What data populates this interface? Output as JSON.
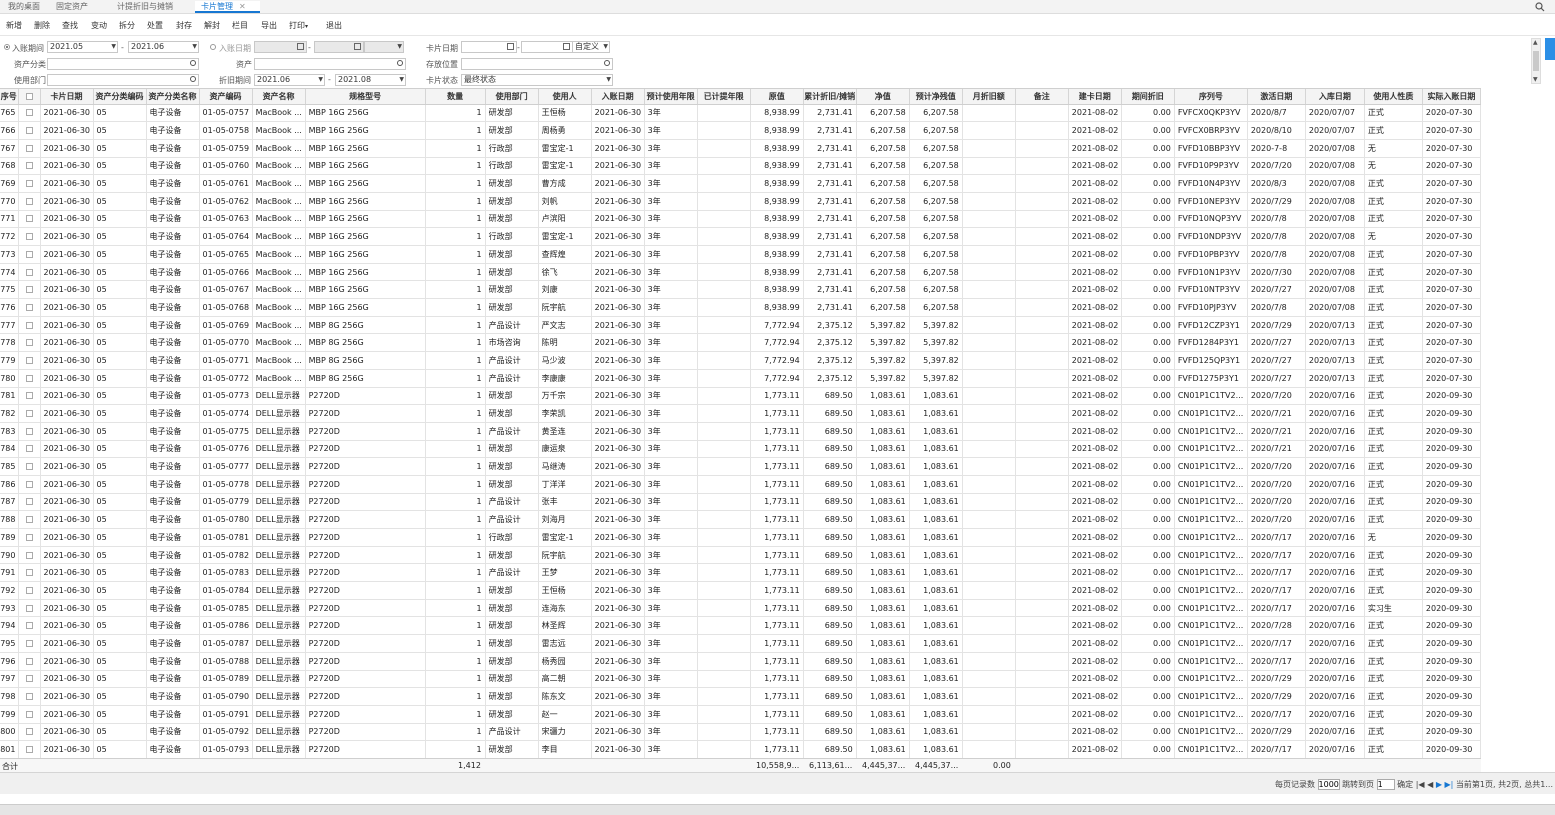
{
  "tabs": [
    {
      "label": "我的桌面",
      "active": false
    },
    {
      "label": "固定资产",
      "active": false
    },
    {
      "label": "计提折旧与摊销",
      "active": false
    },
    {
      "label": "卡片管理",
      "active": true
    }
  ],
  "toolbar": [
    "新增",
    "删除",
    "查找",
    "变动",
    "拆分",
    "处置",
    "封存",
    "解封",
    "栏目",
    "导出",
    "打印",
    "退出"
  ],
  "filters": {
    "entry_period_label": "入账期间",
    "entry_period_from": "2021.05",
    "entry_period_to": "2021.06",
    "entry_date_label": "入账日期",
    "card_date_label": "卡片日期",
    "card_date_mode": "自定义",
    "asset_category_label": "资产分类",
    "asset_label": "资产",
    "storage_label": "存放位置",
    "dept_label": "使用部门",
    "depr_period_label": "折旧期间",
    "depr_period_from": "2021.06",
    "depr_period_to": "2021.08",
    "card_status_label": "卡片状态",
    "card_status_value": "最终状态"
  },
  "columns": [
    "序号",
    "",
    "卡片日期",
    "资产分类编码",
    "资产分类名称",
    "资产编码",
    "资产名称",
    "规格型号",
    "数量",
    "使用部门",
    "使用人",
    "入账日期",
    "预计使用年限",
    "已计提年限",
    "原值",
    "累计折旧/摊销",
    "净值",
    "预计净残值",
    "月折旧额",
    "备注",
    "建卡日期",
    "期间折旧",
    "序列号",
    "激活日期",
    "入库日期",
    "使用人性质",
    "实际入账日期"
  ],
  "rows": [
    [
      "765",
      "",
      "2021-06-30",
      "05",
      "电子设备",
      "01-05-0757",
      "MacBook ...",
      "MBP 16G 256G",
      "1",
      "研发部",
      "王恒杨",
      "2021-06-30",
      "3年",
      "",
      "8,938.99",
      "2,731.41",
      "6,207.58",
      "6,207.58",
      "",
      "",
      "2021-08-02",
      "0.00",
      "FVFCX0QKP3YV",
      "2020/8/7",
      "2020/07/07",
      "正式",
      "2020-07-30"
    ],
    [
      "766",
      "",
      "2021-06-30",
      "05",
      "电子设备",
      "01-05-0758",
      "MacBook ...",
      "MBP 16G 256G",
      "1",
      "研发部",
      "周杨勇",
      "2021-06-30",
      "3年",
      "",
      "8,938.99",
      "2,731.41",
      "6,207.58",
      "6,207.58",
      "",
      "",
      "2021-08-02",
      "0.00",
      "FVFCX0BRP3YV",
      "2020/8/10",
      "2020/07/07",
      "正式",
      "2020-07-30"
    ],
    [
      "767",
      "",
      "2021-06-30",
      "05",
      "电子设备",
      "01-05-0759",
      "MacBook ...",
      "MBP 16G 256G",
      "1",
      "行政部",
      "雷宝定-1",
      "2021-06-30",
      "3年",
      "",
      "8,938.99",
      "2,731.41",
      "6,207.58",
      "6,207.58",
      "",
      "",
      "2021-08-02",
      "0.00",
      "FVFD10BBP3YV",
      "2020-7-8",
      "2020/07/08",
      "无",
      "2020-07-30"
    ],
    [
      "768",
      "",
      "2021-06-30",
      "05",
      "电子设备",
      "01-05-0760",
      "MacBook ...",
      "MBP 16G 256G",
      "1",
      "行政部",
      "雷宝定-1",
      "2021-06-30",
      "3年",
      "",
      "8,938.99",
      "2,731.41",
      "6,207.58",
      "6,207.58",
      "",
      "",
      "2021-08-02",
      "0.00",
      "FVFD10P9P3YV",
      "2020/7/20",
      "2020/07/08",
      "无",
      "2020-07-30"
    ],
    [
      "769",
      "",
      "2021-06-30",
      "05",
      "电子设备",
      "01-05-0761",
      "MacBook ...",
      "MBP 16G 256G",
      "1",
      "研发部",
      "曹方成",
      "2021-06-30",
      "3年",
      "",
      "8,938.99",
      "2,731.41",
      "6,207.58",
      "6,207.58",
      "",
      "",
      "2021-08-02",
      "0.00",
      "FVFD10N4P3YV",
      "2020/8/3",
      "2020/07/08",
      "正式",
      "2020-07-30"
    ],
    [
      "770",
      "",
      "2021-06-30",
      "05",
      "电子设备",
      "01-05-0762",
      "MacBook ...",
      "MBP 16G 256G",
      "1",
      "研发部",
      "刘帆",
      "2021-06-30",
      "3年",
      "",
      "8,938.99",
      "2,731.41",
      "6,207.58",
      "6,207.58",
      "",
      "",
      "2021-08-02",
      "0.00",
      "FVFD10NEP3YV",
      "2020/7/29",
      "2020/07/08",
      "正式",
      "2020-07-30"
    ],
    [
      "771",
      "",
      "2021-06-30",
      "05",
      "电子设备",
      "01-05-0763",
      "MacBook ...",
      "MBP 16G 256G",
      "1",
      "研发部",
      "卢滨阳",
      "2021-06-30",
      "3年",
      "",
      "8,938.99",
      "2,731.41",
      "6,207.58",
      "6,207.58",
      "",
      "",
      "2021-08-02",
      "0.00",
      "FVFD10NQP3YV",
      "2020/7/8",
      "2020/07/08",
      "正式",
      "2020-07-30"
    ],
    [
      "772",
      "",
      "2021-06-30",
      "05",
      "电子设备",
      "01-05-0764",
      "MacBook ...",
      "MBP 16G 256G",
      "1",
      "行政部",
      "雷宝定-1",
      "2021-06-30",
      "3年",
      "",
      "8,938.99",
      "2,731.41",
      "6,207.58",
      "6,207.58",
      "",
      "",
      "2021-08-02",
      "0.00",
      "FVFD10NDP3YV",
      "2020/7/8",
      "2020/07/08",
      "无",
      "2020-07-30"
    ],
    [
      "773",
      "",
      "2021-06-30",
      "05",
      "电子设备",
      "01-05-0765",
      "MacBook ...",
      "MBP 16G 256G",
      "1",
      "研发部",
      "查辉煌",
      "2021-06-30",
      "3年",
      "",
      "8,938.99",
      "2,731.41",
      "6,207.58",
      "6,207.58",
      "",
      "",
      "2021-08-02",
      "0.00",
      "FVFD10PBP3YV",
      "2020/7/8",
      "2020/07/08",
      "正式",
      "2020-07-30"
    ],
    [
      "774",
      "",
      "2021-06-30",
      "05",
      "电子设备",
      "01-05-0766",
      "MacBook ...",
      "MBP 16G 256G",
      "1",
      "研发部",
      "徐飞",
      "2021-06-30",
      "3年",
      "",
      "8,938.99",
      "2,731.41",
      "6,207.58",
      "6,207.58",
      "",
      "",
      "2021-08-02",
      "0.00",
      "FVFD10N1P3YV",
      "2020/7/30",
      "2020/07/08",
      "正式",
      "2020-07-30"
    ],
    [
      "775",
      "",
      "2021-06-30",
      "05",
      "电子设备",
      "01-05-0767",
      "MacBook ...",
      "MBP 16G 256G",
      "1",
      "研发部",
      "刘康",
      "2021-06-30",
      "3年",
      "",
      "8,938.99",
      "2,731.41",
      "6,207.58",
      "6,207.58",
      "",
      "",
      "2021-08-02",
      "0.00",
      "FVFD10NTP3YV",
      "2020/7/27",
      "2020/07/08",
      "正式",
      "2020-07-30"
    ],
    [
      "776",
      "",
      "2021-06-30",
      "05",
      "电子设备",
      "01-05-0768",
      "MacBook ...",
      "MBP 16G 256G",
      "1",
      "研发部",
      "阮宇航",
      "2021-06-30",
      "3年",
      "",
      "8,938.99",
      "2,731.41",
      "6,207.58",
      "6,207.58",
      "",
      "",
      "2021-08-02",
      "0.00",
      "FVFD10PJP3YV",
      "2020/7/8",
      "2020/07/08",
      "正式",
      "2020-07-30"
    ],
    [
      "777",
      "",
      "2021-06-30",
      "05",
      "电子设备",
      "01-05-0769",
      "MacBook ...",
      "MBP 8G 256G",
      "1",
      "产品设计",
      "严文志",
      "2021-06-30",
      "3年",
      "",
      "7,772.94",
      "2,375.12",
      "5,397.82",
      "5,397.82",
      "",
      "",
      "2021-08-02",
      "0.00",
      "FVFD12CZP3Y1",
      "2020/7/29",
      "2020/07/13",
      "正式",
      "2020-07-30"
    ],
    [
      "778",
      "",
      "2021-06-30",
      "05",
      "电子设备",
      "01-05-0770",
      "MacBook ...",
      "MBP 8G 256G",
      "1",
      "市场咨询",
      "陈明",
      "2021-06-30",
      "3年",
      "",
      "7,772.94",
      "2,375.12",
      "5,397.82",
      "5,397.82",
      "",
      "",
      "2021-08-02",
      "0.00",
      "FVFD1284P3Y1",
      "2020/7/27",
      "2020/07/13",
      "正式",
      "2020-07-30"
    ],
    [
      "779",
      "",
      "2021-06-30",
      "05",
      "电子设备",
      "01-05-0771",
      "MacBook ...",
      "MBP 8G 256G",
      "1",
      "产品设计",
      "马少波",
      "2021-06-30",
      "3年",
      "",
      "7,772.94",
      "2,375.12",
      "5,397.82",
      "5,397.82",
      "",
      "",
      "2021-08-02",
      "0.00",
      "FVFD125QP3Y1",
      "2020/7/27",
      "2020/07/13",
      "正式",
      "2020-07-30"
    ],
    [
      "780",
      "",
      "2021-06-30",
      "05",
      "电子设备",
      "01-05-0772",
      "MacBook ...",
      "MBP 8G 256G",
      "1",
      "产品设计",
      "李康康",
      "2021-06-30",
      "3年",
      "",
      "7,772.94",
      "2,375.12",
      "5,397.82",
      "5,397.82",
      "",
      "",
      "2021-08-02",
      "0.00",
      "FVFD1275P3Y1",
      "2020/7/27",
      "2020/07/13",
      "正式",
      "2020-07-30"
    ],
    [
      "781",
      "",
      "2021-06-30",
      "05",
      "电子设备",
      "01-05-0773",
      "DELL显示器",
      "P2720D",
      "1",
      "研发部",
      "万千宗",
      "2021-06-30",
      "3年",
      "",
      "1,773.11",
      "689.50",
      "1,083.61",
      "1,083.61",
      "",
      "",
      "2021-08-02",
      "0.00",
      "CN01P1C1TV2...",
      "2020/7/20",
      "2020/07/16",
      "正式",
      "2020-09-30"
    ],
    [
      "782",
      "",
      "2021-06-30",
      "05",
      "电子设备",
      "01-05-0774",
      "DELL显示器",
      "P2720D",
      "1",
      "研发部",
      "李荣凯",
      "2021-06-30",
      "3年",
      "",
      "1,773.11",
      "689.50",
      "1,083.61",
      "1,083.61",
      "",
      "",
      "2021-08-02",
      "0.00",
      "CN01P1C1TV2...",
      "2020/7/21",
      "2020/07/16",
      "正式",
      "2020-09-30"
    ],
    [
      "783",
      "",
      "2021-06-30",
      "05",
      "电子设备",
      "01-05-0775",
      "DELL显示器",
      "P2720D",
      "1",
      "产品设计",
      "黄圣连",
      "2021-06-30",
      "3年",
      "",
      "1,773.11",
      "689.50",
      "1,083.61",
      "1,083.61",
      "",
      "",
      "2021-08-02",
      "0.00",
      "CN01P1C1TV2...",
      "2020/7/21",
      "2020/07/16",
      "正式",
      "2020-09-30"
    ],
    [
      "784",
      "",
      "2021-06-30",
      "05",
      "电子设备",
      "01-05-0776",
      "DELL显示器",
      "P2720D",
      "1",
      "研发部",
      "康运泉",
      "2021-06-30",
      "3年",
      "",
      "1,773.11",
      "689.50",
      "1,083.61",
      "1,083.61",
      "",
      "",
      "2021-08-02",
      "0.00",
      "CN01P1C1TV2...",
      "2020/7/21",
      "2020/07/16",
      "正式",
      "2020-09-30"
    ],
    [
      "785",
      "",
      "2021-06-30",
      "05",
      "电子设备",
      "01-05-0777",
      "DELL显示器",
      "P2720D",
      "1",
      "研发部",
      "马继涛",
      "2021-06-30",
      "3年",
      "",
      "1,773.11",
      "689.50",
      "1,083.61",
      "1,083.61",
      "",
      "",
      "2021-08-02",
      "0.00",
      "CN01P1C1TV2...",
      "2020/7/20",
      "2020/07/16",
      "正式",
      "2020-09-30"
    ],
    [
      "786",
      "",
      "2021-06-30",
      "05",
      "电子设备",
      "01-05-0778",
      "DELL显示器",
      "P2720D",
      "1",
      "研发部",
      "丁洋洋",
      "2021-06-30",
      "3年",
      "",
      "1,773.11",
      "689.50",
      "1,083.61",
      "1,083.61",
      "",
      "",
      "2021-08-02",
      "0.00",
      "CN01P1C1TV2...",
      "2020/7/20",
      "2020/07/16",
      "正式",
      "2020-09-30"
    ],
    [
      "787",
      "",
      "2021-06-30",
      "05",
      "电子设备",
      "01-05-0779",
      "DELL显示器",
      "P2720D",
      "1",
      "产品设计",
      "张丰",
      "2021-06-30",
      "3年",
      "",
      "1,773.11",
      "689.50",
      "1,083.61",
      "1,083.61",
      "",
      "",
      "2021-08-02",
      "0.00",
      "CN01P1C1TV2...",
      "2020/7/20",
      "2020/07/16",
      "正式",
      "2020-09-30"
    ],
    [
      "788",
      "",
      "2021-06-30",
      "05",
      "电子设备",
      "01-05-0780",
      "DELL显示器",
      "P2720D",
      "1",
      "产品设计",
      "刘海月",
      "2021-06-30",
      "3年",
      "",
      "1,773.11",
      "689.50",
      "1,083.61",
      "1,083.61",
      "",
      "",
      "2021-08-02",
      "0.00",
      "CN01P1C1TV2...",
      "2020/7/20",
      "2020/07/16",
      "正式",
      "2020-09-30"
    ],
    [
      "789",
      "",
      "2021-06-30",
      "05",
      "电子设备",
      "01-05-0781",
      "DELL显示器",
      "P2720D",
      "1",
      "行政部",
      "雷宝定-1",
      "2021-06-30",
      "3年",
      "",
      "1,773.11",
      "689.50",
      "1,083.61",
      "1,083.61",
      "",
      "",
      "2021-08-02",
      "0.00",
      "CN01P1C1TV2...",
      "2020/7/17",
      "2020/07/16",
      "无",
      "2020-09-30"
    ],
    [
      "790",
      "",
      "2021-06-30",
      "05",
      "电子设备",
      "01-05-0782",
      "DELL显示器",
      "P2720D",
      "1",
      "研发部",
      "阮宇航",
      "2021-06-30",
      "3年",
      "",
      "1,773.11",
      "689.50",
      "1,083.61",
      "1,083.61",
      "",
      "",
      "2021-08-02",
      "0.00",
      "CN01P1C1TV2...",
      "2020/7/17",
      "2020/07/16",
      "正式",
      "2020-09-30"
    ],
    [
      "791",
      "",
      "2021-06-30",
      "05",
      "电子设备",
      "01-05-0783",
      "DELL显示器",
      "P2720D",
      "1",
      "产品设计",
      "王梦",
      "2021-06-30",
      "3年",
      "",
      "1,773.11",
      "689.50",
      "1,083.61",
      "1,083.61",
      "",
      "",
      "2021-08-02",
      "0.00",
      "CN01P1C1TV2...",
      "2020/7/17",
      "2020/07/16",
      "正式",
      "2020-09-30"
    ],
    [
      "792",
      "",
      "2021-06-30",
      "05",
      "电子设备",
      "01-05-0784",
      "DELL显示器",
      "P2720D",
      "1",
      "研发部",
      "王恒杨",
      "2021-06-30",
      "3年",
      "",
      "1,773.11",
      "689.50",
      "1,083.61",
      "1,083.61",
      "",
      "",
      "2021-08-02",
      "0.00",
      "CN01P1C1TV2...",
      "2020/7/17",
      "2020/07/16",
      "正式",
      "2020-09-30"
    ],
    [
      "793",
      "",
      "2021-06-30",
      "05",
      "电子设备",
      "01-05-0785",
      "DELL显示器",
      "P2720D",
      "1",
      "研发部",
      "连海东",
      "2021-06-30",
      "3年",
      "",
      "1,773.11",
      "689.50",
      "1,083.61",
      "1,083.61",
      "",
      "",
      "2021-08-02",
      "0.00",
      "CN01P1C1TV2...",
      "2020/7/17",
      "2020/07/16",
      "实习生",
      "2020-09-30"
    ],
    [
      "794",
      "",
      "2021-06-30",
      "05",
      "电子设备",
      "01-05-0786",
      "DELL显示器",
      "P2720D",
      "1",
      "研发部",
      "林圣辉",
      "2021-06-30",
      "3年",
      "",
      "1,773.11",
      "689.50",
      "1,083.61",
      "1,083.61",
      "",
      "",
      "2021-08-02",
      "0.00",
      "CN01P1C1TV2...",
      "2020/7/28",
      "2020/07/16",
      "正式",
      "2020-09-30"
    ],
    [
      "795",
      "",
      "2021-06-30",
      "05",
      "电子设备",
      "01-05-0787",
      "DELL显示器",
      "P2720D",
      "1",
      "研发部",
      "雷志远",
      "2021-06-30",
      "3年",
      "",
      "1,773.11",
      "689.50",
      "1,083.61",
      "1,083.61",
      "",
      "",
      "2021-08-02",
      "0.00",
      "CN01P1C1TV2...",
      "2020/7/17",
      "2020/07/16",
      "正式",
      "2020-09-30"
    ],
    [
      "796",
      "",
      "2021-06-30",
      "05",
      "电子设备",
      "01-05-0788",
      "DELL显示器",
      "P2720D",
      "1",
      "研发部",
      "杨秀园",
      "2021-06-30",
      "3年",
      "",
      "1,773.11",
      "689.50",
      "1,083.61",
      "1,083.61",
      "",
      "",
      "2021-08-02",
      "0.00",
      "CN01P1C1TV2...",
      "2020/7/17",
      "2020/07/16",
      "正式",
      "2020-09-30"
    ],
    [
      "797",
      "",
      "2021-06-30",
      "05",
      "电子设备",
      "01-05-0789",
      "DELL显示器",
      "P2720D",
      "1",
      "研发部",
      "高二朝",
      "2021-06-30",
      "3年",
      "",
      "1,773.11",
      "689.50",
      "1,083.61",
      "1,083.61",
      "",
      "",
      "2021-08-02",
      "0.00",
      "CN01P1C1TV2...",
      "2020/7/29",
      "2020/07/16",
      "正式",
      "2020-09-30"
    ],
    [
      "798",
      "",
      "2021-06-30",
      "05",
      "电子设备",
      "01-05-0790",
      "DELL显示器",
      "P2720D",
      "1",
      "研发部",
      "陈东文",
      "2021-06-30",
      "3年",
      "",
      "1,773.11",
      "689.50",
      "1,083.61",
      "1,083.61",
      "",
      "",
      "2021-08-02",
      "0.00",
      "CN01P1C1TV2...",
      "2020/7/29",
      "2020/07/16",
      "正式",
      "2020-09-30"
    ],
    [
      "799",
      "",
      "2021-06-30",
      "05",
      "电子设备",
      "01-05-0791",
      "DELL显示器",
      "P2720D",
      "1",
      "研发部",
      "赵一",
      "2021-06-30",
      "3年",
      "",
      "1,773.11",
      "689.50",
      "1,083.61",
      "1,083.61",
      "",
      "",
      "2021-08-02",
      "0.00",
      "CN01P1C1TV2...",
      "2020/7/17",
      "2020/07/16",
      "正式",
      "2020-09-30"
    ],
    [
      "800",
      "",
      "2021-06-30",
      "05",
      "电子设备",
      "01-05-0792",
      "DELL显示器",
      "P2720D",
      "1",
      "产品设计",
      "宋疆力",
      "2021-06-30",
      "3年",
      "",
      "1,773.11",
      "689.50",
      "1,083.61",
      "1,083.61",
      "",
      "",
      "2021-08-02",
      "0.00",
      "CN01P1C1TV2...",
      "2020/7/29",
      "2020/07/16",
      "正式",
      "2020-09-30"
    ],
    [
      "801",
      "",
      "2021-06-30",
      "05",
      "电子设备",
      "01-05-0793",
      "DELL显示器",
      "P2720D",
      "1",
      "研发部",
      "李目",
      "2021-06-30",
      "3年",
      "",
      "1,773.11",
      "689.50",
      "1,083.61",
      "1,083.61",
      "",
      "",
      "2021-08-02",
      "0.00",
      "CN01P1C1TV2...",
      "2020/7/17",
      "2020/07/16",
      "正式",
      "2020-09-30"
    ]
  ],
  "totals": {
    "label": "合计",
    "quantity": "1,412",
    "original_value": "10,558,9...",
    "accum_depr": "6,113,61...",
    "net_value": "4,445,37...",
    "residual": "4,445,37...",
    "period_depr": "0.00"
  },
  "pager": {
    "per_page_label": "每页记录数",
    "per_page": "1000",
    "jump_label": "跳转到页",
    "jump_page": "1",
    "confirm": "确定",
    "first": "|◀",
    "prev": "◀",
    "next": "▶",
    "last": "▶|",
    "info": "当前第1页, 共2页, 总共1..."
  }
}
